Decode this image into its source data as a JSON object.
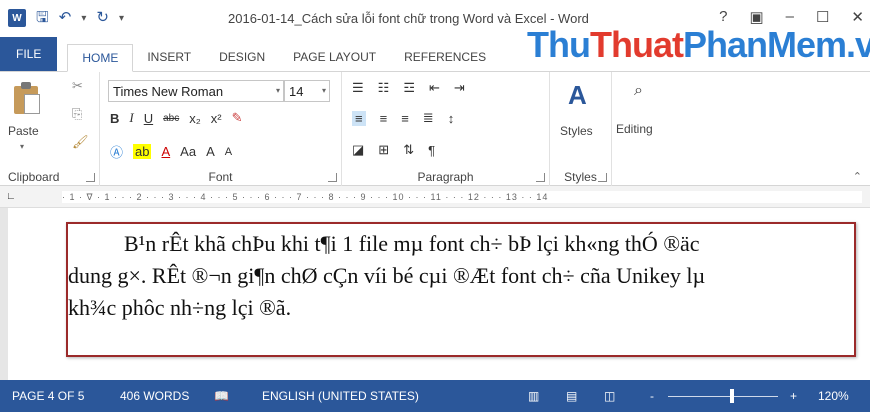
{
  "titlebar": {
    "title": "2016-01-14_Cách sửa lỗi font chữ trong Word và Excel - Word",
    "app_icon": "W",
    "help": "?",
    "window_controls": [
      "ribbon-display-icon",
      "minimize-icon",
      "maximize-icon",
      "close-icon"
    ]
  },
  "tabs": [
    "FILE",
    "HOME",
    "INSERT",
    "DESIGN",
    "PAGE LAYOUT",
    "REFERENCES"
  ],
  "watermark": {
    "part1": "Thu",
    "part2": "Thuat",
    "part3": "PhanMem",
    "part4": ".vn"
  },
  "clipboard": {
    "paste": "Paste",
    "label": "Clipboard"
  },
  "font": {
    "name": "Times New Roman",
    "size": "14",
    "label": "Font",
    "bold": "B",
    "italic": "I",
    "underline": "U",
    "strike": "abc",
    "sub": "x₂",
    "sup": "x²",
    "case": "Aa",
    "grow": "A",
    "shrink": "A"
  },
  "paragraph": {
    "label": "Paragraph"
  },
  "styles": {
    "styles_btn": "Styles",
    "label": "Styles"
  },
  "editing": {
    "editing_btn": "Editing"
  },
  "ruler": {
    "scale": "· 1 · ∇ · 1 · · · 2 · · · 3 · · · 4 · · · 5 · · · 6 · · · 7 · · · 8 · · · 9 · · · 10 · · · 11 · · · 12 · · · 13 · · 14"
  },
  "document": {
    "lines": [
      "B¹n rÊt khã chÞu khi t¶i 1 file mµ font ch÷ bÞ lçi kh«ng thÓ ®äc",
      "dung g×. RÊt ®¬n gi¶n chØ cÇn víi bé cµi ®Æt font ch÷ cña Unikey lµ",
      "kh¾c phôc nh÷ng lçi ®ã."
    ]
  },
  "status": {
    "page": "PAGE 4 OF 5",
    "words": "406 WORDS",
    "language": "ENGLISH (UNITED STATES)",
    "zoom": "120%",
    "zoom_minus": "-",
    "zoom_plus": "+"
  }
}
